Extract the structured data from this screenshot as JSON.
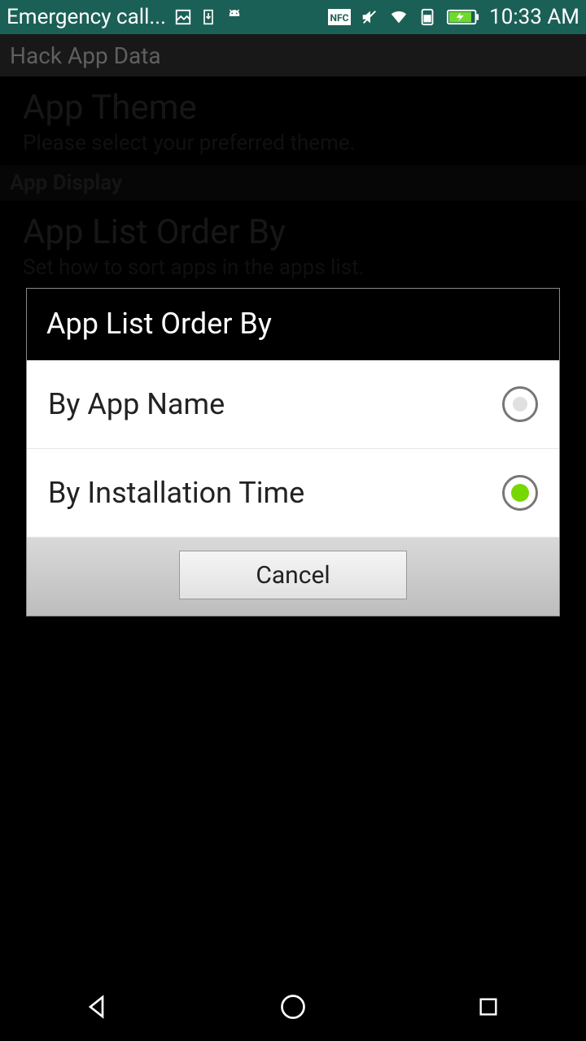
{
  "status": {
    "left_text": "Emergency call...",
    "time": "10:33 AM"
  },
  "app_header": {
    "title": "Hack App Data"
  },
  "settings": {
    "theme_title": "App Theme",
    "theme_desc": "Please select your preferred theme.",
    "display_header": "App Display",
    "order_title": "App List Order By",
    "order_desc": "Set how to sort apps in the apps list."
  },
  "dialog": {
    "title": "App List Order By",
    "option1": "By App Name",
    "option2": "By Installation Time",
    "cancel": "Cancel",
    "selected_index": 1
  }
}
